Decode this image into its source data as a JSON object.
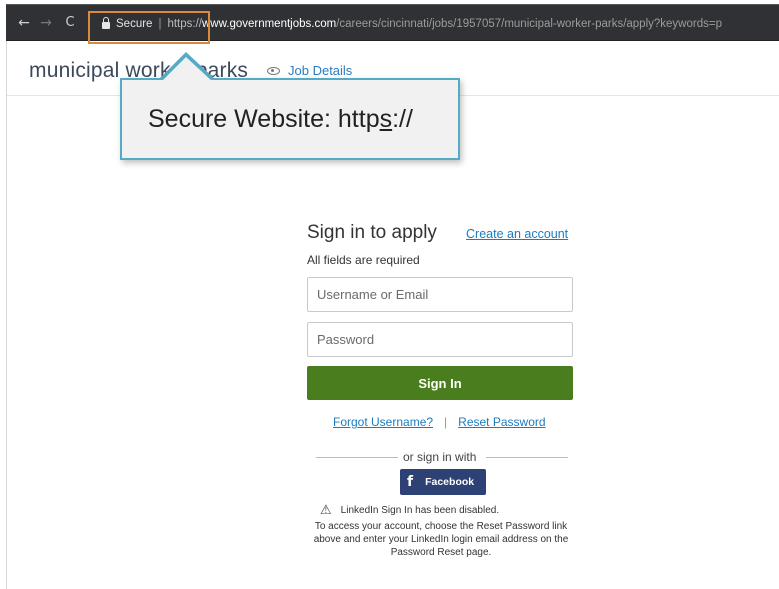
{
  "browser": {
    "back_icon": "arrow-left-icon",
    "forward_icon": "arrow-right-icon",
    "reload_icon": "reload-icon",
    "lock_icon": "lock-icon",
    "secure_label": "Secure",
    "url_scheme": "https://",
    "url_host": "www.governmentjobs.com",
    "url_path": "/careers/cincinnati/jobs/1957057/municipal-worker-parks/apply?keywords=p",
    "highlight_color": "#d98a3a"
  },
  "header": {
    "job_title": "municipal worker parks",
    "job_details_label": "Job Details",
    "eye_icon": "eye-icon"
  },
  "callout": {
    "text_prefix": "Secure Website: http",
    "text_underlined": "s",
    "text_suffix": "://",
    "border_color": "#55aac6"
  },
  "signin": {
    "title": "Sign in to apply",
    "create_account": "Create an account",
    "fields_required": "All fields are required",
    "username_placeholder": "Username or Email",
    "password_placeholder": "Password",
    "signin_button": "Sign In",
    "signin_button_color": "#4a7d1d",
    "forgot_username": "Forgot Username?",
    "separator": "|",
    "reset_password": "Reset Password",
    "or_sign_in_with": "or sign in with",
    "facebook_icon": "f",
    "facebook_label": "Facebook",
    "facebook_color": "#2d4174",
    "linkedin_note": "LinkedIn Sign In has been disabled.",
    "help_text": "To access your account, choose the Reset Password link above and enter your LinkedIn login email address on the Password Reset page."
  }
}
